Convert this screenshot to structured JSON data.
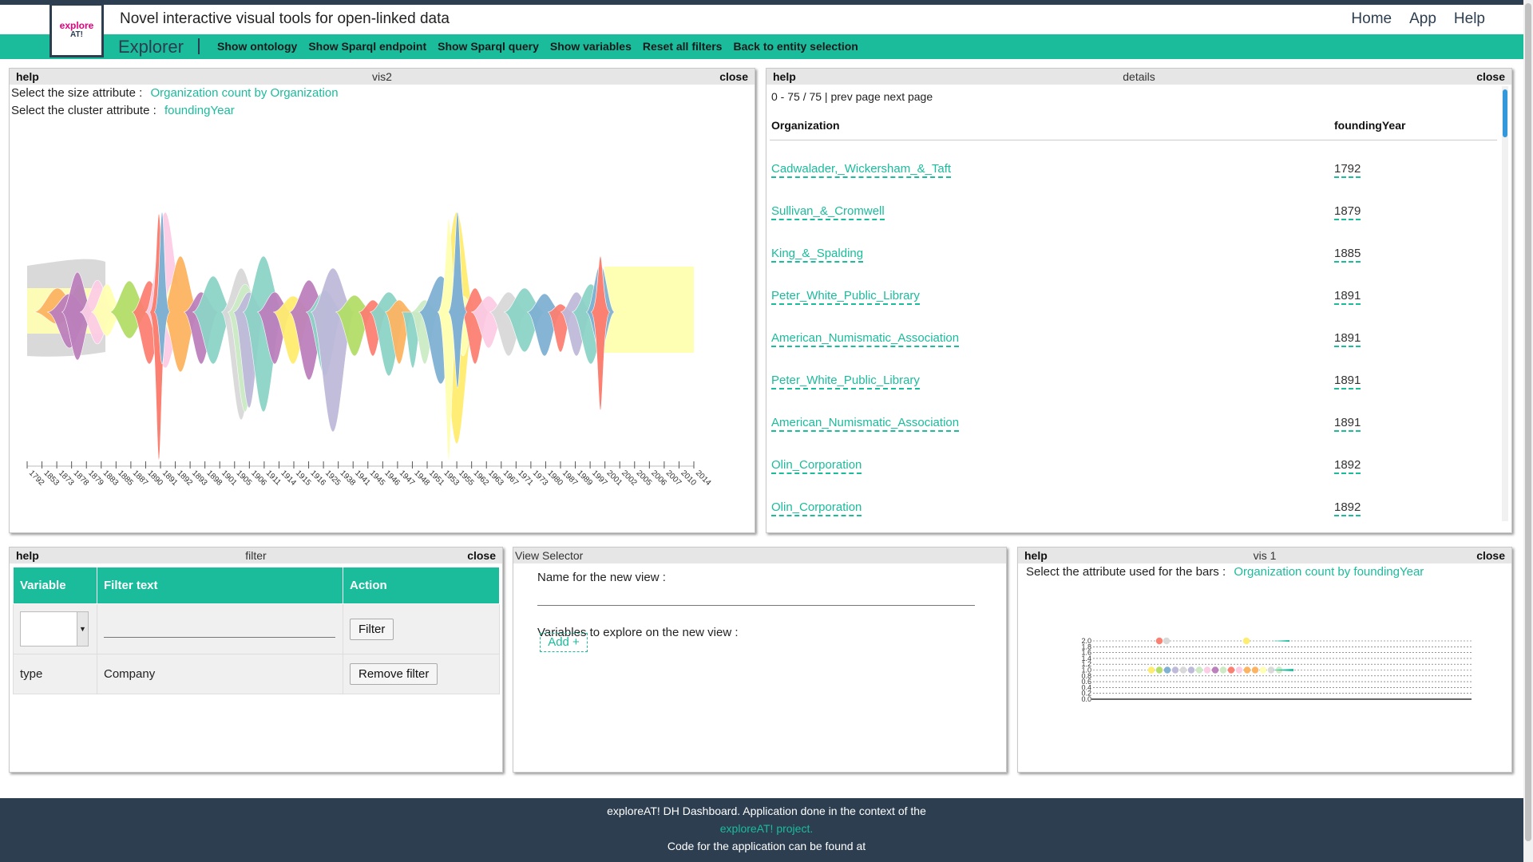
{
  "header": {
    "logo_main": "explore",
    "logo_sub": "AT!",
    "title": "Novel interactive visual tools for open-linked data",
    "nav": [
      "Home",
      "App",
      "Help"
    ]
  },
  "subnav": {
    "section": "Explorer",
    "links": [
      "Show ontology",
      "Show Sparql endpoint",
      "Show Sparql query",
      "Show variables",
      "Reset all filters",
      "Back to entity selection"
    ]
  },
  "vis2": {
    "help": "help",
    "title": "vis2",
    "close": "close",
    "size_label": "Select the size attribute :",
    "size_value": "Organization count by Organization",
    "cluster_label": "Select the cluster attribute :",
    "cluster_value": "foundingYear"
  },
  "details": {
    "help": "help",
    "title": "details",
    "close": "close",
    "pager": "0 - 75 / 75 | prev page next page",
    "col_org": "Organization",
    "col_year": "foundingYear",
    "rows": [
      {
        "org": "Cadwalader,_Wickersham_&_Taft",
        "year": "1792"
      },
      {
        "org": "Sullivan_&_Cromwell",
        "year": "1879"
      },
      {
        "org": "King_&_Spalding",
        "year": "1885"
      },
      {
        "org": "Peter_White_Public_Library",
        "year": "1891"
      },
      {
        "org": "American_Numismatic_Association",
        "year": "1891"
      },
      {
        "org": "Peter_White_Public_Library",
        "year": "1891"
      },
      {
        "org": "American_Numismatic_Association",
        "year": "1891"
      },
      {
        "org": "Olin_Corporation",
        "year": "1892"
      },
      {
        "org": "Olin_Corporation",
        "year": "1892"
      }
    ]
  },
  "filter": {
    "help": "help",
    "title": "filter",
    "close": "close",
    "col_variable": "Variable",
    "col_text": "Filter text",
    "col_action": "Action",
    "filter_btn": "Filter",
    "row_variable": "type",
    "row_text": "Company",
    "remove_btn": "Remove filter"
  },
  "view_selector": {
    "title": "View Selector",
    "name_label": "Name for the new view :",
    "vars_label": "Variables to explore on the new view :",
    "add_btn": "Add +"
  },
  "vis1": {
    "help": "help",
    "title": "vis 1",
    "close": "close",
    "attr_label": "Select the attribute used for the bars :",
    "attr_value": "Organization count by foundingYear"
  },
  "footer": {
    "line1": "exploreAT! DH Dashboard. Application done in the context of the",
    "link": "exploreAT! project.",
    "line2": "Code for the application can be found at"
  },
  "chart_data": [
    {
      "type": "area",
      "chart": "streamgraph",
      "x_ticks": [
        "1792",
        "1853",
        "1873",
        "1878",
        "1879",
        "1883",
        "1885",
        "1887",
        "1890",
        "1891",
        "1892",
        "1893",
        "1898",
        "1901",
        "1905",
        "1906",
        "1911",
        "1914",
        "1915",
        "1916",
        "1925",
        "1938",
        "1941",
        "1945",
        "1946",
        "1947",
        "1948",
        "1951",
        "1953",
        "1955",
        "1962",
        "1963",
        "1967",
        "1971",
        "1973",
        "1980",
        "1987",
        "1989",
        "1997",
        "2001",
        "2002",
        "2005",
        "2006",
        "2007",
        "2010",
        "2014"
      ],
      "grid": false,
      "legend": "none"
    },
    {
      "type": "scatter",
      "y_ticks": [
        "0.0",
        "0.2",
        "0.4",
        "0.6",
        "0.8",
        "1.0",
        "1.2",
        "1.4",
        "1.6",
        "1.8",
        "2.0"
      ],
      "ylim": [
        0,
        2
      ],
      "grid": true,
      "legend": "none",
      "series": [
        {
          "values": [
            1,
            1,
            1,
            1,
            1,
            1,
            1,
            1,
            1,
            1,
            1,
            1,
            1,
            1,
            1,
            1,
            1
          ]
        },
        {
          "values": [
            2,
            2,
            2
          ]
        }
      ],
      "colors": [
        "#8dd3c7",
        "#ffffb3",
        "#bebada",
        "#fb8072",
        "#80b1d3",
        "#fdb462",
        "#b3de69",
        "#fccde5",
        "#d9d9d9",
        "#bc80bd",
        "#ccebc5",
        "#ffed6f"
      ]
    }
  ]
}
